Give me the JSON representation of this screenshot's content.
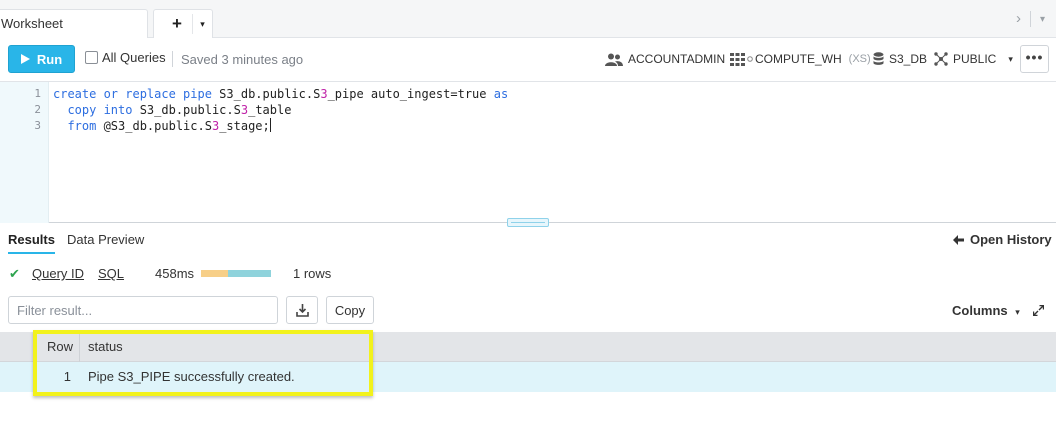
{
  "tabbar": {
    "tab_label": "Worksheet",
    "add": "+",
    "caret": "▾",
    "nav_next": "›",
    "nav_menu": "▾"
  },
  "toolbar": {
    "run_label": "Run",
    "all_queries_label": "All Queries",
    "saved_text": "Saved 3 minutes ago",
    "role": "ACCOUNTADMIN",
    "warehouse": "COMPUTE_WH",
    "warehouse_size": "(XS)",
    "database": "S3_DB",
    "schema": "PUBLIC",
    "more": "•••"
  },
  "editor": {
    "lines": [
      {
        "num": "1"
      },
      {
        "num": "2"
      },
      {
        "num": "3"
      }
    ],
    "tokens": {
      "l1_kw1": "create or replace pipe",
      "l1_a": " S3_db.public.S",
      "l1_3": "3",
      "l1_b": "_pipe auto_ingest=true ",
      "l1_kw2": "as",
      "l2_indent": "  ",
      "l2_kw": "copy into",
      "l2_a": " S3_db.public.S",
      "l2_3": "3",
      "l2_b": "_table",
      "l3_indent": "  ",
      "l3_kw": "from",
      "l3_a": " @S3_db.public.S",
      "l3_3": "3",
      "l3_b": "_stage;"
    }
  },
  "results_tabs": {
    "results": "Results",
    "preview": "Data Preview",
    "open_history": "Open History"
  },
  "query": {
    "check": "✔",
    "query_id": "Query ID",
    "sql": "SQL",
    "duration": "458ms",
    "timing_fractions": [
      0.38,
      0.62
    ],
    "timing_colors": [
      "#f7cf88",
      "#8fd3dc"
    ],
    "rows": "1 rows"
  },
  "filter": {
    "placeholder": "Filter result...",
    "copy_label": "Copy",
    "columns_label": "Columns",
    "columns_caret": "▾"
  },
  "table": {
    "headers": [
      "Row",
      "status"
    ],
    "rows": [
      {
        "row": "1",
        "status": "Pipe S3_PIPE successfully created."
      }
    ]
  },
  "colors": {
    "accent": "#29b5e8",
    "highlight": "#f2f21c",
    "success": "#2ea44f"
  }
}
